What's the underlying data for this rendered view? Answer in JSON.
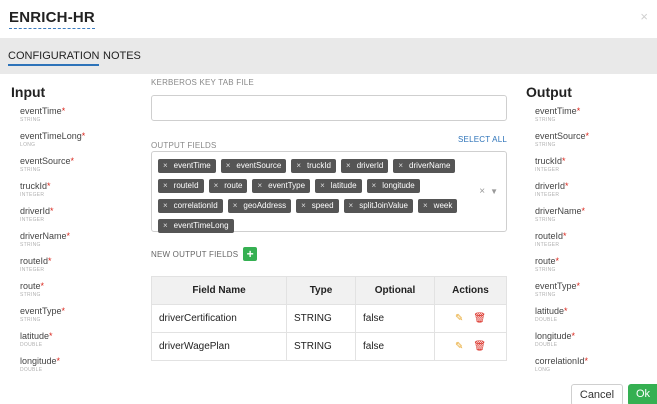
{
  "dialog": {
    "title": "ENRICH-HR",
    "close": "×"
  },
  "tabs": [
    {
      "label": "CONFIGURATION",
      "active": true
    },
    {
      "label": "NOTES",
      "active": false
    }
  ],
  "input_panel": {
    "title": "Input",
    "fields": [
      {
        "name": "eventTime",
        "type": "STRING",
        "required": "*"
      },
      {
        "name": "eventTimeLong",
        "type": "LONG",
        "required": "*"
      },
      {
        "name": "eventSource",
        "type": "STRING",
        "required": "*"
      },
      {
        "name": "truckId",
        "type": "INTEGER",
        "required": "*"
      },
      {
        "name": "driverId",
        "type": "INTEGER",
        "required": "*"
      },
      {
        "name": "driverName",
        "type": "STRING",
        "required": "*"
      },
      {
        "name": "routeId",
        "type": "INTEGER",
        "required": "*"
      },
      {
        "name": "route",
        "type": "STRING",
        "required": "*"
      },
      {
        "name": "eventType",
        "type": "STRING",
        "required": "*"
      },
      {
        "name": "latitude",
        "type": "DOUBLE",
        "required": "*"
      },
      {
        "name": "longitude",
        "type": "DOUBLE",
        "required": "*"
      }
    ]
  },
  "output_panel": {
    "title": "Output",
    "fields": [
      {
        "name": "eventTime",
        "type": "STRING",
        "required": "*"
      },
      {
        "name": "eventSource",
        "type": "STRING",
        "required": "*"
      },
      {
        "name": "truckId",
        "type": "INTEGER",
        "required": "*"
      },
      {
        "name": "driverId",
        "type": "INTEGER",
        "required": "*"
      },
      {
        "name": "driverName",
        "type": "STRING",
        "required": "*"
      },
      {
        "name": "routeId",
        "type": "INTEGER",
        "required": "*"
      },
      {
        "name": "route",
        "type": "STRING",
        "required": "*"
      },
      {
        "name": "eventType",
        "type": "STRING",
        "required": "*"
      },
      {
        "name": "latitude",
        "type": "DOUBLE",
        "required": "*"
      },
      {
        "name": "longitude",
        "type": "DOUBLE",
        "required": "*"
      },
      {
        "name": "correlationId",
        "type": "LONG",
        "required": "*"
      }
    ]
  },
  "config": {
    "kerberos_label": "KERBEROS KEY TAB FILE",
    "kerberos_value": "",
    "output_fields_label": "OUTPUT FIELDS",
    "select_all": "SELECT ALL",
    "tag_remove": "×",
    "tags": [
      "eventTime",
      "eventSource",
      "truckId",
      "driverId",
      "driverName",
      "routeId",
      "route",
      "eventType",
      "latitude",
      "longitude",
      "correlationId",
      "geoAddress",
      "speed",
      "splitJoinValue",
      "week",
      "eventTimeLong"
    ],
    "clear_tags": "×",
    "caret": "▼",
    "new_output_fields_label": "NEW OUTPUT FIELDS",
    "add_label": "+"
  },
  "table": {
    "headers": [
      "Field Name",
      "Type",
      "Optional",
      "Actions"
    ],
    "rows": [
      {
        "field": "driverCertification",
        "type": "STRING",
        "optional": "false"
      },
      {
        "field": "driverWagePlan",
        "type": "STRING",
        "optional": "false"
      }
    ]
  },
  "footer": {
    "cancel": "Cancel",
    "ok": "Ok"
  },
  "colors": {
    "accent_blue": "#2d73b9",
    "ok_green": "#35b052",
    "required_red": "#d9261c",
    "edit_orange": "#e8a62a",
    "tag_dark": "#555555"
  }
}
